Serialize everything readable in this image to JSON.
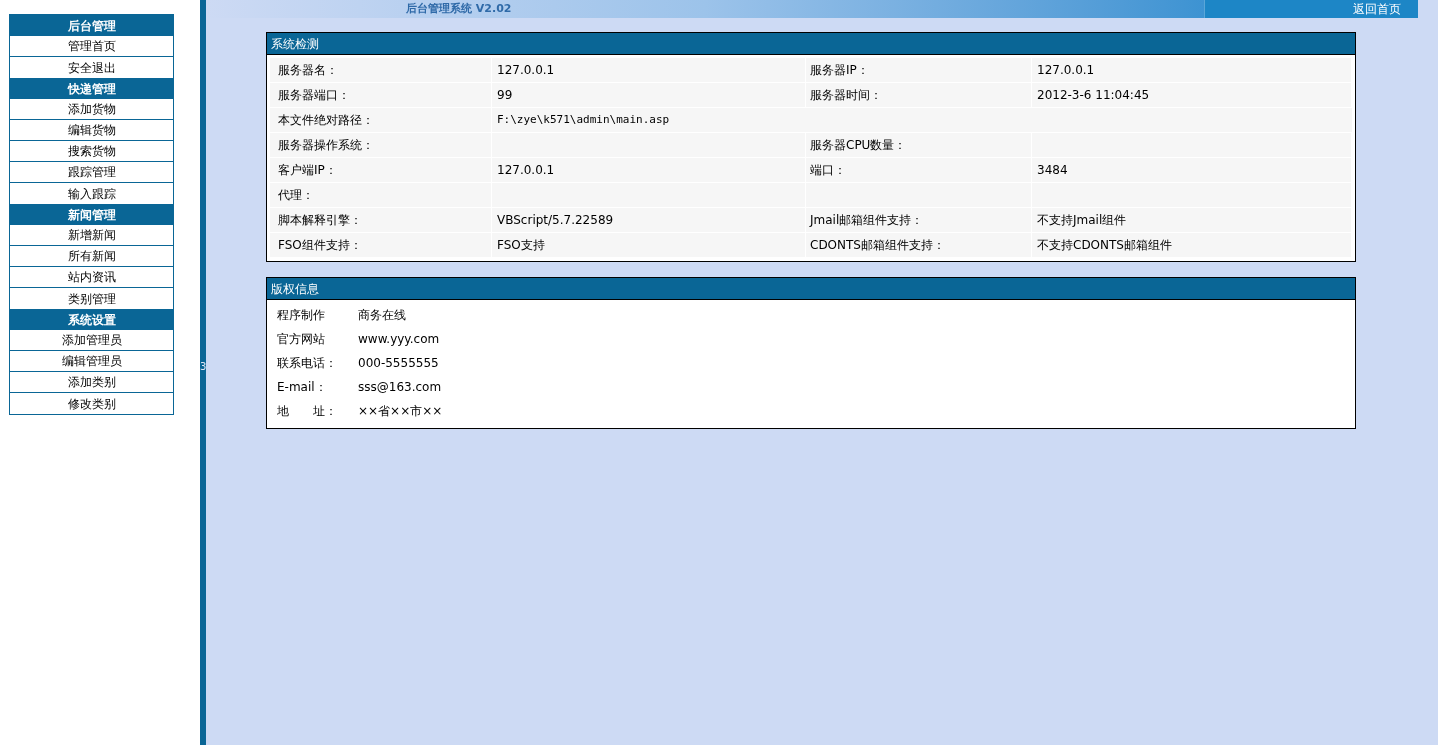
{
  "sidebar": {
    "sections": [
      {
        "title": "后台管理",
        "items": [
          "管理首页",
          "安全退出"
        ]
      },
      {
        "title": "快递管理",
        "items": [
          "添加货物",
          "编辑货物",
          "搜索货物",
          "跟踪管理",
          "输入跟踪"
        ]
      },
      {
        "title": "新闻管理",
        "items": [
          "新增新闻",
          "所有新闻",
          "站内资讯",
          "类别管理"
        ]
      },
      {
        "title": "系统设置",
        "items": [
          "添加管理员",
          "编辑管理员",
          "添加类别",
          "修改类别"
        ]
      }
    ]
  },
  "divider_mark": "3",
  "header": {
    "title": "后台管理系统 V2.02",
    "home_link": "返回首页"
  },
  "system_check": {
    "title": "系统检测",
    "rows": [
      [
        "服务器名：",
        "127.0.0.1",
        "服务器IP：",
        "127.0.0.1"
      ],
      [
        "服务器端口：",
        "99",
        "服务器时间：",
        "2012-3-6 11:04:45"
      ],
      [
        "本文件绝对路径：",
        "F:\\zye\\k571\\admin\\main.asp"
      ],
      [
        "服务器操作系统：",
        "",
        "服务器CPU数量：",
        ""
      ],
      [
        "客户端IP：",
        "127.0.0.1",
        "端口：",
        "3484"
      ],
      [
        "代理：",
        "",
        "",
        ""
      ],
      [
        "脚本解释引擎：",
        "VBScript/5.7.22589",
        "Jmail邮箱组件支持：",
        "不支持Jmail组件"
      ],
      [
        "FSO组件支持：",
        "FSO支持",
        "CDONTS邮箱组件支持：",
        "不支持CDONTS邮箱组件"
      ]
    ]
  },
  "copyright": {
    "title": "版权信息",
    "rows": [
      [
        "程序制作",
        "商务在线"
      ],
      [
        "官方网站",
        "www.yyy.com"
      ],
      [
        "联系电话：",
        "000-5555555"
      ],
      [
        "E-mail：",
        "sss@163.com"
      ],
      [
        "地　　址：",
        "××省××市××"
      ]
    ]
  }
}
